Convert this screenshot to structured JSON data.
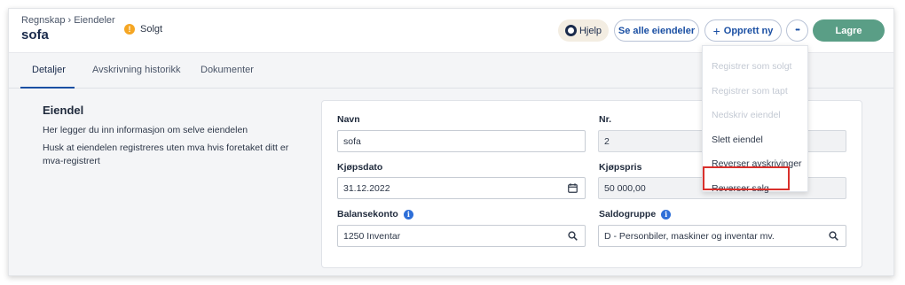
{
  "header": {
    "breadcrumb": [
      "Regnskap",
      "Eiendeler"
    ],
    "breadcrumb_sep": "›",
    "title": "sofa",
    "status_icon": "!",
    "status": "Solgt"
  },
  "toolbar": {
    "help_label": "Hjelp",
    "all_assets_label": "Se alle eiendeler",
    "create_label": "Opprett ny",
    "create_icon": "+",
    "more_icon": "•••",
    "save_label": "Lagre"
  },
  "tabs": [
    {
      "label": "Detaljer",
      "active": true
    },
    {
      "label": "Avskrivning historikk",
      "active": false
    },
    {
      "label": "Dokumenter",
      "active": false
    }
  ],
  "section": {
    "title": "Eiendel",
    "description": [
      "Her legger du inn informasjon om selve eiendelen",
      "Husk at eiendelen registreres uten mva hvis foretaket ditt er mva-registrert"
    ]
  },
  "form": {
    "name": {
      "label": "Navn",
      "value": "sofa"
    },
    "number": {
      "label": "Nr.",
      "value": "2"
    },
    "purchase_date": {
      "label": "Kjøpsdato",
      "value": "31.12.2022"
    },
    "purchase_price": {
      "label": "Kjøpspris",
      "value": "50 000,00"
    },
    "balance_account": {
      "label": "Balansekonto",
      "value": "1250 Inventar"
    },
    "balance_group": {
      "label": "Saldogruppe",
      "value": "D - Personbiler, maskiner og inventar mv."
    },
    "info_icon": "i"
  },
  "menu": {
    "items": [
      {
        "label": "Registrer som solgt",
        "enabled": false
      },
      {
        "label": "Registrer som tapt",
        "enabled": false
      },
      {
        "label": "Nedskriv eiendel",
        "enabled": false
      },
      {
        "label": "Slett eiendel",
        "enabled": true
      },
      {
        "label": "Reverser avskrivinger",
        "enabled": true
      },
      {
        "label": "Reverser salg",
        "enabled": true,
        "highlighted": true
      }
    ]
  },
  "colors": {
    "accent": "#1a4fa3",
    "save_button": "#5a9e86",
    "status_warning": "#f5a623",
    "highlight": "#d9302c"
  }
}
